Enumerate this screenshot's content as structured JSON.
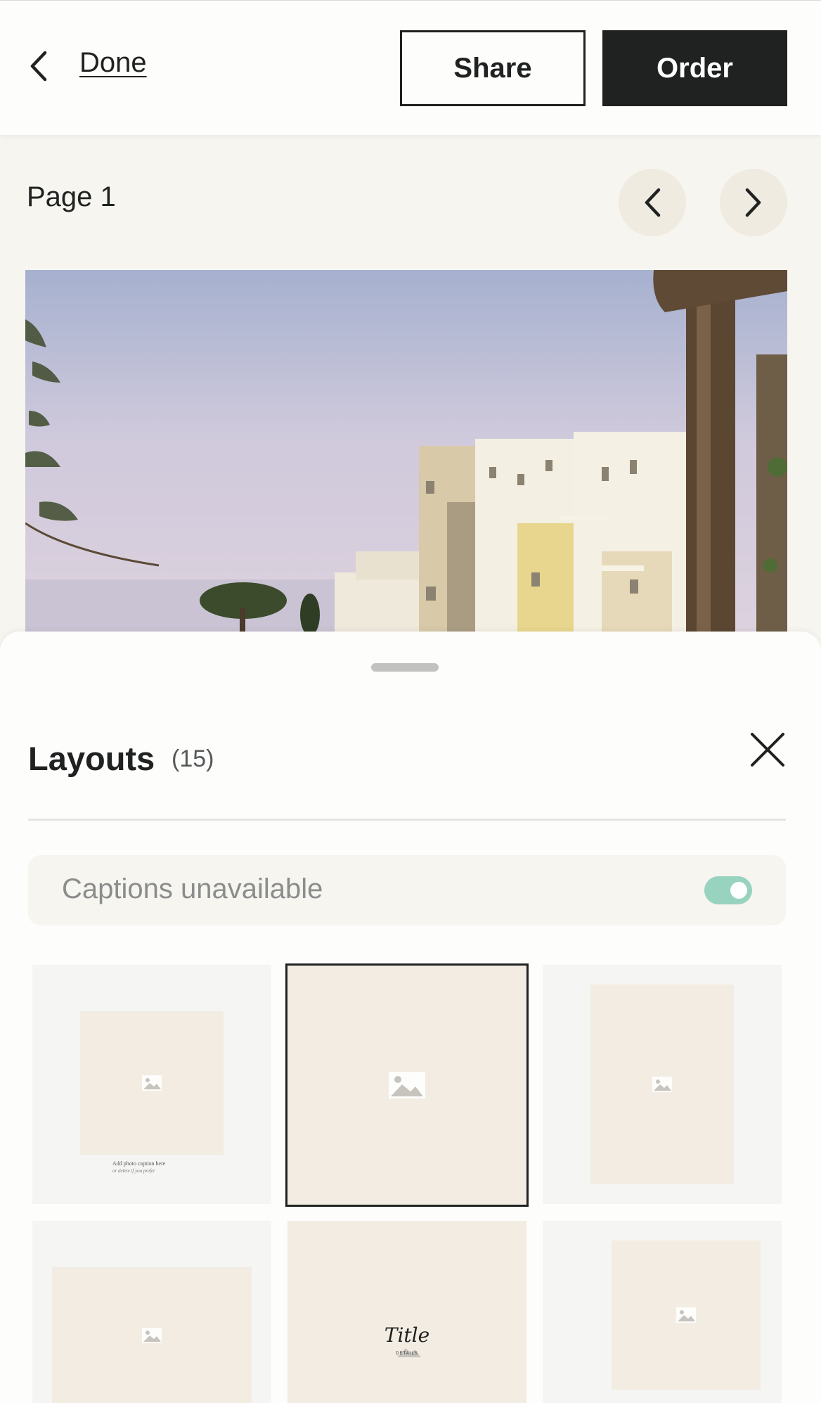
{
  "topbar": {
    "back_icon": "chevron-left-icon",
    "done_label": "Done",
    "share_label": "Share",
    "order_label": "Order"
  },
  "page": {
    "label": "Page 1",
    "prev_icon": "chevron-left-icon",
    "next_icon": "chevron-right-icon"
  },
  "photo": {
    "description_icon": "photo"
  },
  "sheet": {
    "title": "Layouts",
    "count": "(15)",
    "close_icon": "close-icon",
    "captions_label": "Captions unavailable",
    "captions_toggle_on": true
  },
  "layouts": {
    "tile1_caption": "Add photo caption here",
    "tile1_caption_sub": "or delete if you prefer",
    "tile5_title": "Title",
    "tile5_details": "DETAILS",
    "selected_index": 2
  },
  "colors": {
    "dark": "#1f2221",
    "placeholder": "#f2ece2",
    "toggle": "#98d3c0",
    "nav_circle": "#f0ebe0"
  }
}
